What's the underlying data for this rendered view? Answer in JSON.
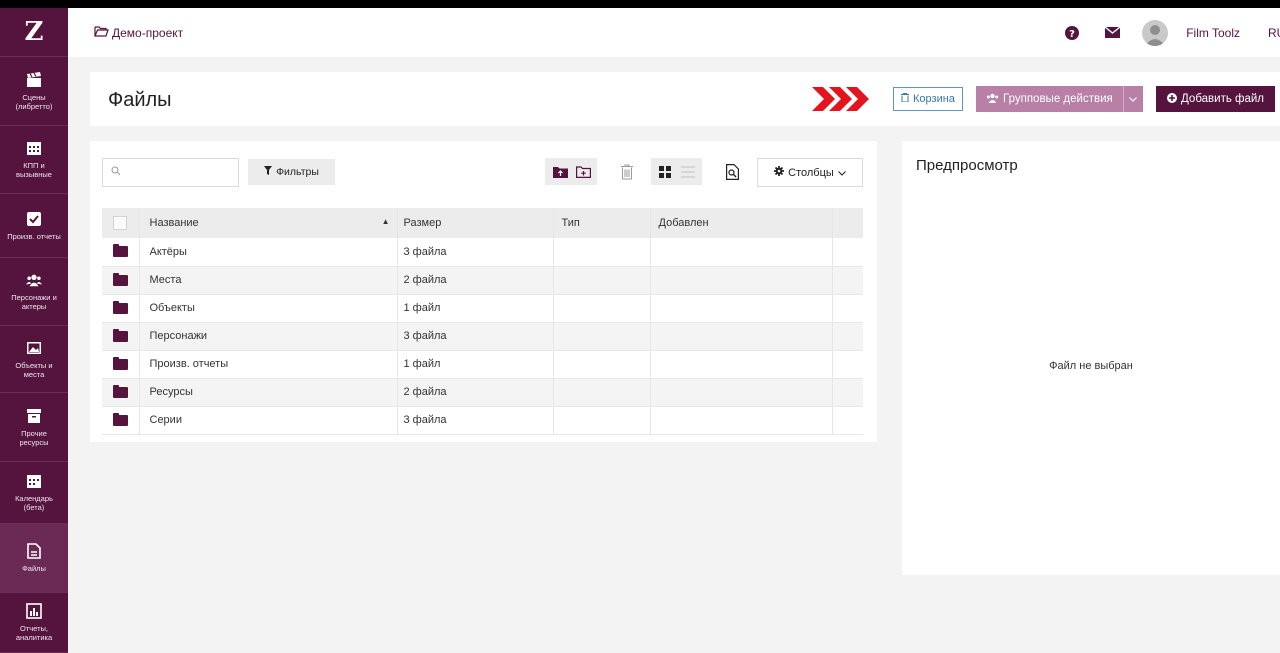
{
  "app": {
    "logo": "Z"
  },
  "sidebar": {
    "items": [
      {
        "label": "Сцены\n(либретто)",
        "icon": "clapperboard-icon"
      },
      {
        "label": "КПП и\nвызывные",
        "icon": "calendar-grid-icon"
      },
      {
        "label": "Произв. отчеты",
        "icon": "checkbox-icon"
      },
      {
        "label": "Персонажи и\nактеры",
        "icon": "users-icon"
      },
      {
        "label": "Объекты и\nместа",
        "icon": "image-icon"
      },
      {
        "label": "Прочие\nресурсы",
        "icon": "archive-icon"
      },
      {
        "label": "Календарь\n(бета)",
        "icon": "calendar-icon"
      },
      {
        "label": "Файлы",
        "icon": "file-icon"
      },
      {
        "label": "Отчеты,\nаналитика",
        "icon": "bar-chart-icon"
      }
    ],
    "active": "Файлы"
  },
  "topbar": {
    "breadcrumb": "Демо-проект",
    "username": "Film Toolz",
    "language": "RU"
  },
  "header": {
    "title": "Файлы",
    "trash_label": "Корзина",
    "group_actions_label": "Групповые действия",
    "add_file_label": "Добавить файл"
  },
  "toolbar": {
    "search_placeholder": "",
    "filters_label": "Фильтры",
    "columns_label": "Столбцы"
  },
  "table": {
    "headers": [
      "Название",
      "Размер",
      "Тип",
      "Добавлен"
    ],
    "rows": [
      {
        "name": "Актёры",
        "size": "3 файла",
        "type": "",
        "added": ""
      },
      {
        "name": "Места",
        "size": "2 файла",
        "type": "",
        "added": ""
      },
      {
        "name": "Объекты",
        "size": "1 файл",
        "type": "",
        "added": ""
      },
      {
        "name": "Персонажи",
        "size": "3 файла",
        "type": "",
        "added": ""
      },
      {
        "name": "Произв. отчеты",
        "size": "1 файл",
        "type": "",
        "added": ""
      },
      {
        "name": "Ресурсы",
        "size": "2 файла",
        "type": "",
        "added": ""
      },
      {
        "name": "Серии",
        "size": "3 файла",
        "type": "",
        "added": ""
      }
    ]
  },
  "preview": {
    "title": "Предпросмотр",
    "empty_text": "Файл не выбран"
  },
  "colors": {
    "brand": "#55143d",
    "brand_light": "#b87fa7",
    "accent_red": "#e3141d",
    "link_blue": "#3678b2"
  }
}
